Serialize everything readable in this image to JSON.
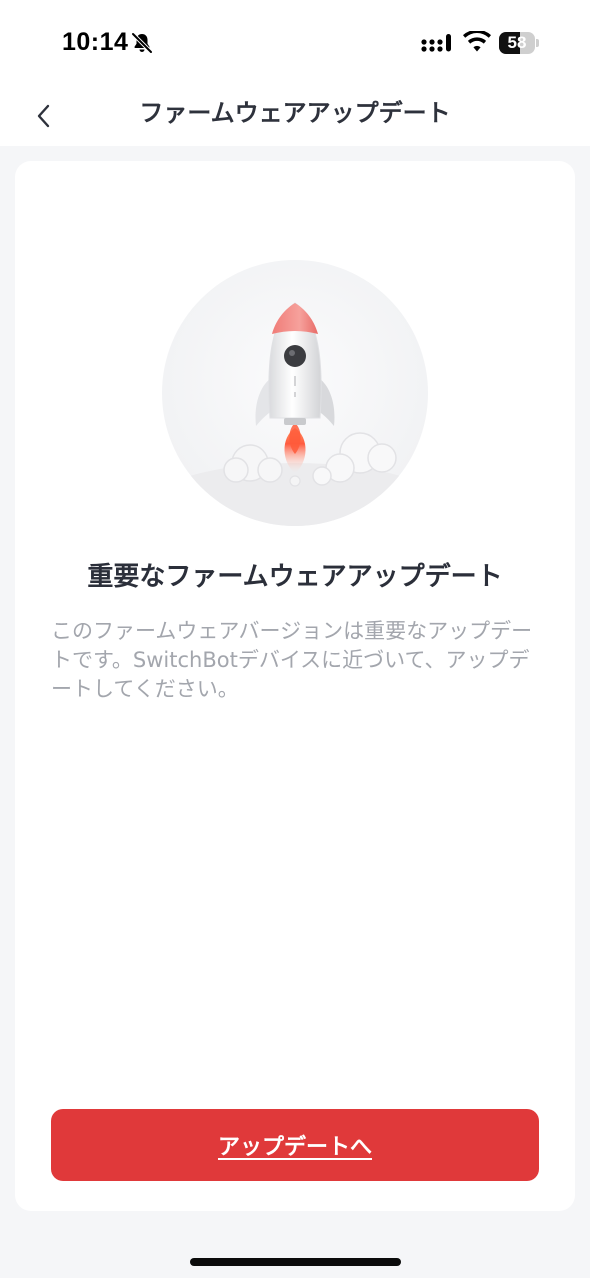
{
  "status_bar": {
    "time": "10:14",
    "battery_level": "58",
    "battery_fraction": 0.58,
    "icons": [
      "bell-muted-icon",
      "signal-icon",
      "wifi-icon",
      "battery-icon"
    ]
  },
  "nav": {
    "title": "ファームウェアアップデート",
    "back_icon": "chevron-left-icon"
  },
  "card": {
    "illustration": "rocket-launch-icon",
    "heading": "重要なファームウェアアップデート",
    "description": "このファームウェアバージョンは重要なアップデートです。SwitchBotデバイスに近づいて、アップデートしてください。"
  },
  "actions": {
    "update_label": "アップデートへ"
  },
  "colors": {
    "accent": "#e0393a",
    "background": "#f5f6f8",
    "card": "#ffffff",
    "heading": "#2b2f3a",
    "muted_text": "#a3a6ad"
  }
}
